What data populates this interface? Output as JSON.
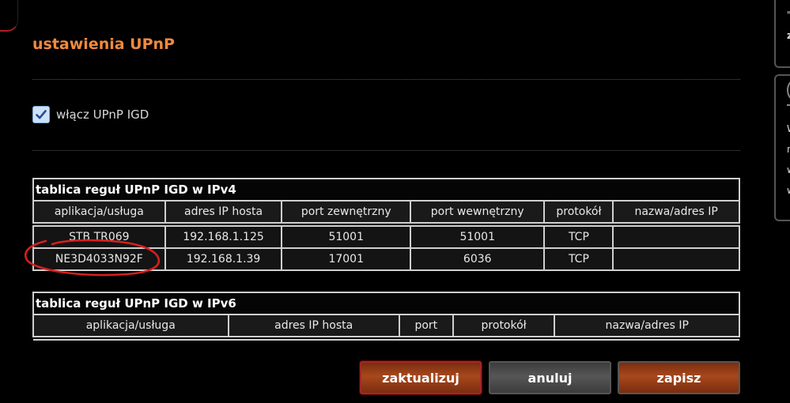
{
  "page": {
    "title": "ustawienia UPnP"
  },
  "upnp_toggle": {
    "label": "włącz UPnP IGD",
    "checked": true
  },
  "ipv4_table": {
    "caption": "tablica reguł UPnP IGD w IPv4",
    "columns": [
      "aplikacja/usługa",
      "adres IP hosta",
      "port zewnętrzny",
      "port wewnętrzny",
      "protokół",
      "nazwa/adres IP"
    ],
    "rows": [
      [
        "STB TR069",
        "192.168.1.125",
        "51001",
        "51001",
        "TCP",
        ""
      ],
      [
        "NE3D4033N92F",
        "192.168.1.39",
        "17001",
        "6036",
        "TCP",
        ""
      ]
    ]
  },
  "ipv6_table": {
    "caption": "tablica reguł UPnP IGD w IPv6",
    "columns": [
      "aplikacja/usługa",
      "adres IP hosta",
      "port",
      "protokół",
      "nazwa/adres IP"
    ],
    "rows": []
  },
  "buttons": {
    "update": "zaktualizuj",
    "cancel": "anuluj",
    "save": "zapisz"
  },
  "side_panel": {
    "top_chars": [
      "\"",
      "z"
    ],
    "bottom_chars": [
      "W",
      "n",
      "w",
      "w"
    ]
  },
  "colors": {
    "accent": "#f08a3e",
    "annotation": "#d42020"
  }
}
